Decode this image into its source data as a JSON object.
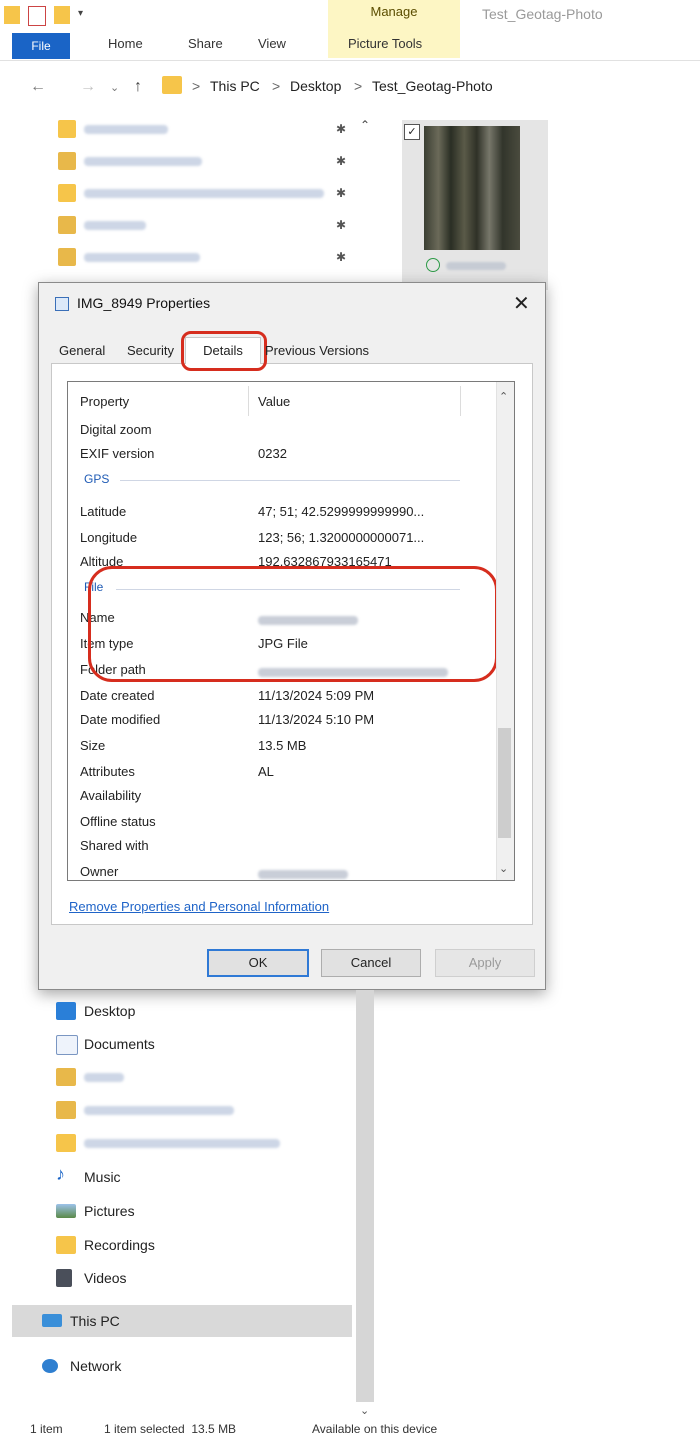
{
  "ribbon": {
    "manage_label": "Manage",
    "window_title": "Test_Geotag-Photo",
    "file_tab": "File",
    "tabs": [
      "Home",
      "Share",
      "View",
      "Picture Tools"
    ]
  },
  "address": {
    "breadcrumb": [
      "This PC",
      "Desktop",
      "Test_Geotag-Photo"
    ],
    "separator": ">"
  },
  "dialog": {
    "title": "IMG_8949 Properties",
    "close": "✕",
    "tabs": {
      "general": "General",
      "security": "Security",
      "details": "Details",
      "previous": "Previous Versions"
    },
    "columns": {
      "property": "Property",
      "value": "Value"
    },
    "rows_top": [
      {
        "name": "Digital zoom",
        "value": ""
      },
      {
        "name": "EXIF version",
        "value": "0232"
      }
    ],
    "gps_group": "GPS",
    "gps_rows": [
      {
        "name": "Latitude",
        "value": "47; 51; 42.5299999999990..."
      },
      {
        "name": "Longitude",
        "value": "123; 56; 1.3200000000071..."
      },
      {
        "name": "Altitude",
        "value": "192.632867933165471"
      }
    ],
    "file_group": "File",
    "file_rows": [
      {
        "name": "Name",
        "value": ""
      },
      {
        "name": "Item type",
        "value": "JPG File"
      },
      {
        "name": "Folder path",
        "value": ""
      },
      {
        "name": "Date created",
        "value": "11/13/2024 5:09 PM"
      },
      {
        "name": "Date modified",
        "value": "11/13/2024 5:10 PM"
      },
      {
        "name": "Size",
        "value": "13.5 MB"
      },
      {
        "name": "Attributes",
        "value": "AL"
      },
      {
        "name": "Availability",
        "value": ""
      },
      {
        "name": "Offline status",
        "value": ""
      },
      {
        "name": "Shared with",
        "value": ""
      },
      {
        "name": "Owner",
        "value": ""
      }
    ],
    "remove_link": "Remove Properties and Personal Information",
    "buttons": {
      "ok": "OK",
      "cancel": "Cancel",
      "apply": "Apply"
    }
  },
  "nav_lower": {
    "desktop": "Desktop",
    "documents": "Documents",
    "music": "Music",
    "pictures": "Pictures",
    "recordings": "Recordings",
    "videos": "Videos",
    "this_pc": "This PC",
    "network": "Network"
  },
  "status": {
    "items": "1 item",
    "selected": "1 item selected  13.5 MB",
    "availability": "Available on this device"
  },
  "colors": {
    "accent": "#1a64c6",
    "highlight_ring": "#d62d1e",
    "manage_bg": "#fdf6c4",
    "link": "#1f64c8"
  }
}
